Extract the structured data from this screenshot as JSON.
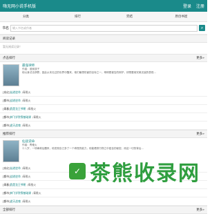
{
  "topbar": {
    "title": "嗨无网小说手机版",
    "login": "登录",
    "register": "注册"
  },
  "nav": [
    "分类",
    "排行",
    "完结",
    "原创书屋"
  ],
  "search": {
    "label": "书名",
    "placeholder": "输入书名或作者"
  },
  "read_history": {
    "title": "阅读记录",
    "empty": "暂无阅读记录！"
  },
  "hot": {
    "title": "点击排行",
    "more": "更多»",
    "feature": {
      "title": "最强律师",
      "author": "作者：谁家孩子",
      "desc": "他以身试法获罪，因此从未见过的世界中醒来，他们最想伤害的目标之一，明明是被告的辩护，却想要用完美无缺的表现..."
    },
    "items": [
      {
        "tag": "[玄幻]",
        "name": "仙途逆命",
        "author": "/青稚火"
      },
      {
        "tag": "[都市]",
        "name": "战途逆命",
        "author": "/青稚火"
      },
      {
        "tag": "[青春]",
        "name": "我是龙王爷朝",
        "author": "/青稚火"
      },
      {
        "tag": "[都市]",
        "name": "神飞学院零基础课",
        "author": "/青稚火"
      },
      {
        "tag": "[都市]",
        "name": "逆天战魂",
        "author": "/青稚火"
      }
    ]
  },
  "recommend": {
    "title": "推荐排行",
    "more": "更多»",
    "feature": {
      "title": "仙途逆命",
      "author": "作者：青稚火",
      "desc": "十八岁，一场事故后醒来，他发现自己多了一个奇怪的能力，他能看穿万物之中蕴含的秘密，而这一切的背后..."
    },
    "items": [
      {
        "tag": "[玄幻]",
        "name": "仙途逆命",
        "author": "/青稚火"
      },
      {
        "tag": "[都市]",
        "name": "战途逆命",
        "author": "/青稚火"
      },
      {
        "tag": "[青春]",
        "name": "我是龙王爷朝",
        "author": "/青稚火"
      },
      {
        "tag": "[都市]",
        "name": "神飞学院零基础课",
        "author": "/青稚火"
      },
      {
        "tag": "[都市]",
        "name": "逆天战魂",
        "author": "/青稚火"
      }
    ]
  },
  "latest": {
    "title": "全部排行",
    "more": "更多»"
  },
  "watermark": {
    "text": "茶熊收录网"
  }
}
